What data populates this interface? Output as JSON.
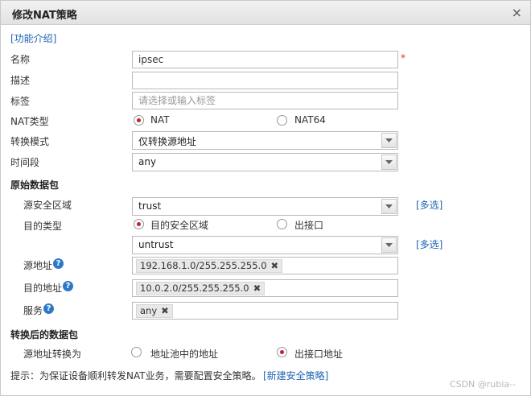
{
  "dialog": {
    "title": "修改NAT策略",
    "close": "×"
  },
  "intro_link": "[功能介绍]",
  "fields": {
    "name": {
      "label": "名称",
      "value": "ipsec",
      "required": "*"
    },
    "desc": {
      "label": "描述",
      "value": ""
    },
    "tag": {
      "label": "标签",
      "placeholder": "请选择或输入标签"
    },
    "nat_type": {
      "label": "NAT类型",
      "options": [
        "NAT",
        "NAT64"
      ],
      "selected": "NAT"
    },
    "mode": {
      "label": "转换模式",
      "value": "仅转换源地址"
    },
    "time": {
      "label": "时间段",
      "value": "any"
    }
  },
  "original_packet": {
    "section": "原始数据包",
    "src_zone": {
      "label": "源安全区域",
      "value": "trust",
      "multi": "[多选]"
    },
    "dst_type": {
      "label": "目的类型",
      "options": [
        "目的安全区域",
        "出接口"
      ],
      "selected": "目的安全区域"
    },
    "dst_zone": {
      "value": "untrust",
      "multi": "[多选]"
    },
    "src_addr": {
      "label": "源地址",
      "help": "?",
      "chips": [
        "192.168.1.0/255.255.255.0"
      ]
    },
    "dst_addr": {
      "label": "目的地址",
      "help": "?",
      "chips": [
        "10.0.2.0/255.255.255.0"
      ]
    },
    "service": {
      "label": "服务",
      "help": "?",
      "chips": [
        "any"
      ]
    }
  },
  "translated_packet": {
    "section": "转换后的数据包",
    "src_translate": {
      "label": "源地址转换为",
      "options": [
        "地址池中的地址",
        "出接口地址"
      ],
      "selected": "出接口地址"
    }
  },
  "tip": {
    "text": "提示：为保证设备顺利转发NAT业务，需要配置安全策略。",
    "link": "[新建安全策略]"
  },
  "watermark": "CSDN @rubia--",
  "colors": {
    "radio_selected": "#c0222f",
    "link": "#1e64b4",
    "required": "#dd3333"
  },
  "chip_remove_glyph": "✖"
}
